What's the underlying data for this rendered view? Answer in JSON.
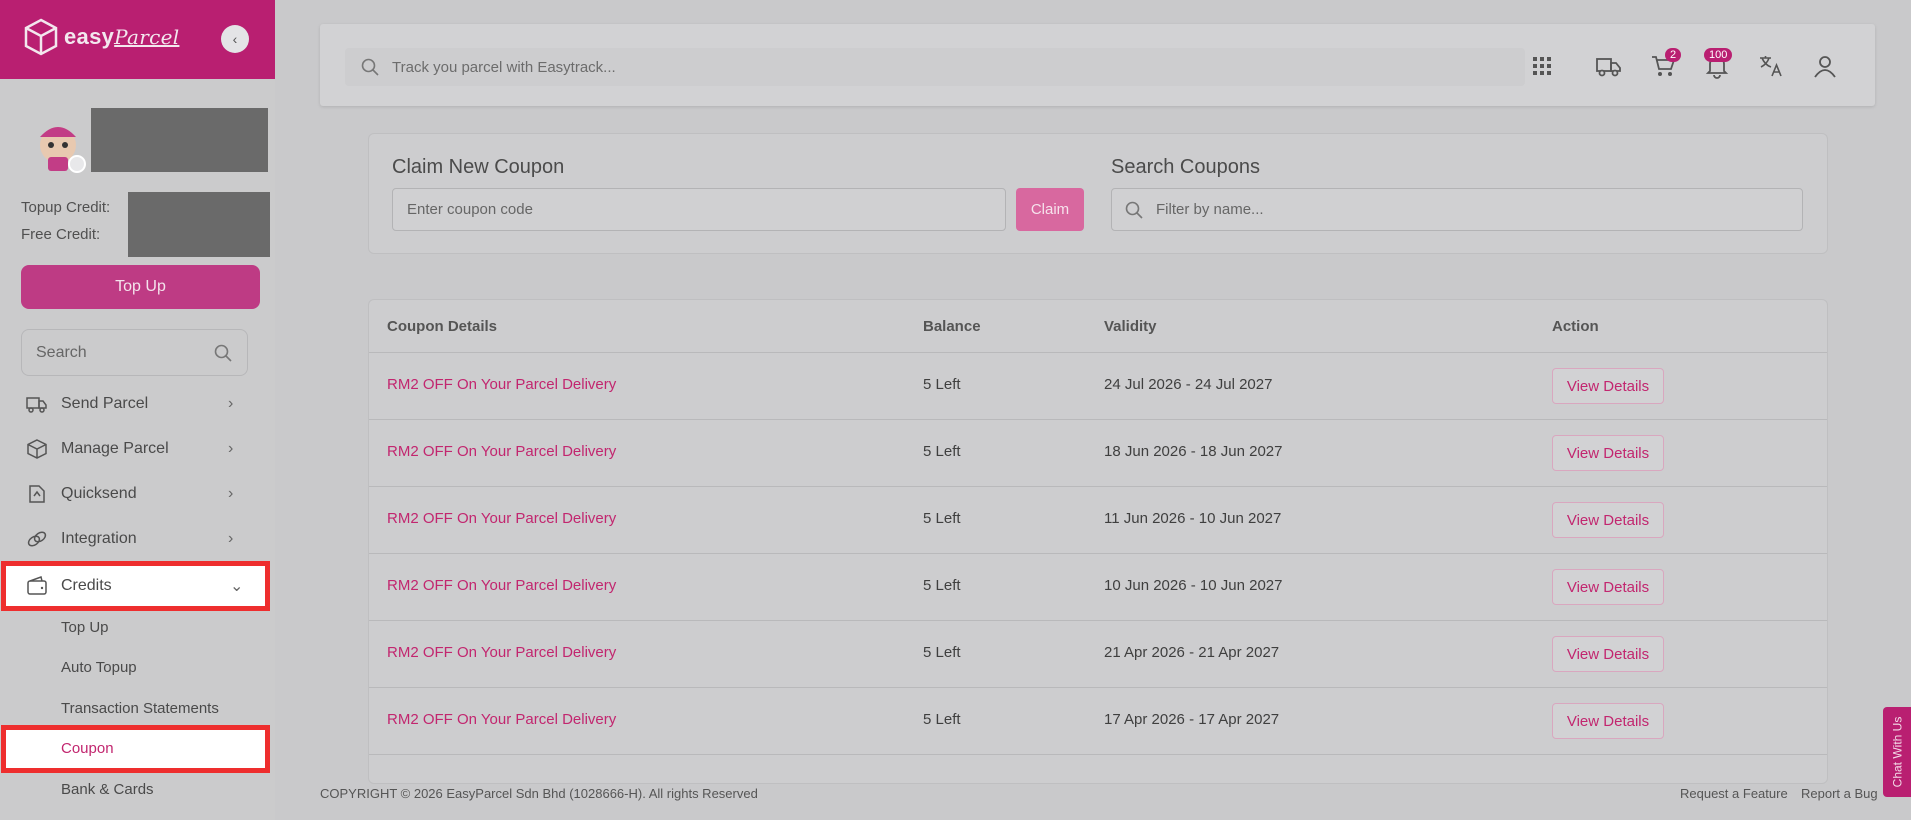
{
  "brand": {
    "name_bold": "easy",
    "name_script": "Parcel",
    "accent": "#b91f71"
  },
  "sidebar": {
    "credit_labels": {
      "topup": "Topup Credit:",
      "free": "Free Credit:"
    },
    "topup_button": "Top Up",
    "search_placeholder": "Search",
    "nav": [
      {
        "label": "Send Parcel",
        "icon": "truck-icon"
      },
      {
        "label": "Manage Parcel",
        "icon": "box-icon"
      },
      {
        "label": "Quicksend",
        "icon": "quicksend-icon"
      },
      {
        "label": "Integration",
        "icon": "link-icon"
      },
      {
        "label": "Credits",
        "icon": "wallet-icon",
        "expanded": true
      }
    ],
    "credits_sub": [
      "Top Up",
      "Auto Topup",
      "Transaction Statements",
      "Coupon",
      "Bank & Cards"
    ],
    "active_sub": "Coupon"
  },
  "header": {
    "track_placeholder": "Track you parcel with Easytrack...",
    "cart_count": "2",
    "notification_count": "100"
  },
  "claim": {
    "title": "Claim New Coupon",
    "input_placeholder": "Enter coupon code",
    "button": "Claim"
  },
  "search_coupons": {
    "title": "Search Coupons",
    "placeholder": "Filter by name..."
  },
  "table": {
    "headers": [
      "Coupon Details",
      "Balance",
      "Validity",
      "Action"
    ],
    "rows": [
      {
        "name": "RM2 OFF On Your Parcel Delivery",
        "balance": "5 Left",
        "validity": "24 Jul 2026 - 24 Jul 2027",
        "action": "View Details"
      },
      {
        "name": "RM2 OFF On Your Parcel Delivery",
        "balance": "5 Left",
        "validity": "18 Jun 2026 - 18 Jun 2027",
        "action": "View Details"
      },
      {
        "name": "RM2 OFF On Your Parcel Delivery",
        "balance": "5 Left",
        "validity": "11 Jun 2026 - 10 Jun 2027",
        "action": "View Details"
      },
      {
        "name": "RM2 OFF On Your Parcel Delivery",
        "balance": "5 Left",
        "validity": "10 Jun 2026 - 10 Jun 2027",
        "action": "View Details"
      },
      {
        "name": "RM2 OFF On Your Parcel Delivery",
        "balance": "5 Left",
        "validity": "21 Apr 2026 - 21 Apr 2027",
        "action": "View Details"
      },
      {
        "name": "RM2 OFF On Your Parcel Delivery",
        "balance": "5 Left",
        "validity": "17 Apr 2026 - 17 Apr 2027",
        "action": "View Details"
      }
    ]
  },
  "footer": {
    "copyright": "COPYRIGHT © 2026 EasyParcel Sdn Bhd (1028666-H). All rights Reserved",
    "request_feature": "Request a Feature",
    "report_bug": "Report a Bug"
  },
  "chat_tab": "Chat With Us"
}
